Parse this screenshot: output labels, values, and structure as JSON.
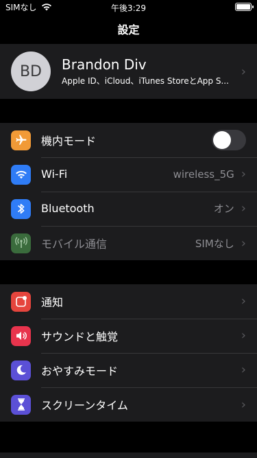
{
  "status": {
    "carrier": "SIMなし",
    "time": "午後3:29"
  },
  "nav": {
    "title": "設定"
  },
  "profile": {
    "initials": "BD",
    "name": "Brandon Div",
    "subtitle": "Apple ID、iCloud、iTunes StoreとApp S..."
  },
  "connectivity": [
    {
      "label": "機内モード",
      "value": "",
      "icon": "airplane-icon",
      "color": "#f19a37",
      "toggle": true
    },
    {
      "label": "Wi-Fi",
      "value": "wireless_5G",
      "icon": "wifi-icon",
      "color": "#2f7cf6"
    },
    {
      "label": "Bluetooth",
      "value": "オン",
      "icon": "bluetooth-icon",
      "color": "#2f7cf6"
    },
    {
      "label": "モバイル通信",
      "value": "SIMなし",
      "icon": "antenna-icon",
      "color": "#3a6b3c"
    }
  ],
  "notifications": [
    {
      "label": "通知",
      "icon": "notification-icon",
      "color": "#e5453d"
    },
    {
      "label": "サウンドと触覚",
      "icon": "sound-icon",
      "color": "#e8344d"
    },
    {
      "label": "おやすみモード",
      "icon": "moon-icon",
      "color": "#5b50d6"
    },
    {
      "label": "スクリーンタイム",
      "icon": "hourglass-icon",
      "color": "#5b50d6"
    }
  ]
}
